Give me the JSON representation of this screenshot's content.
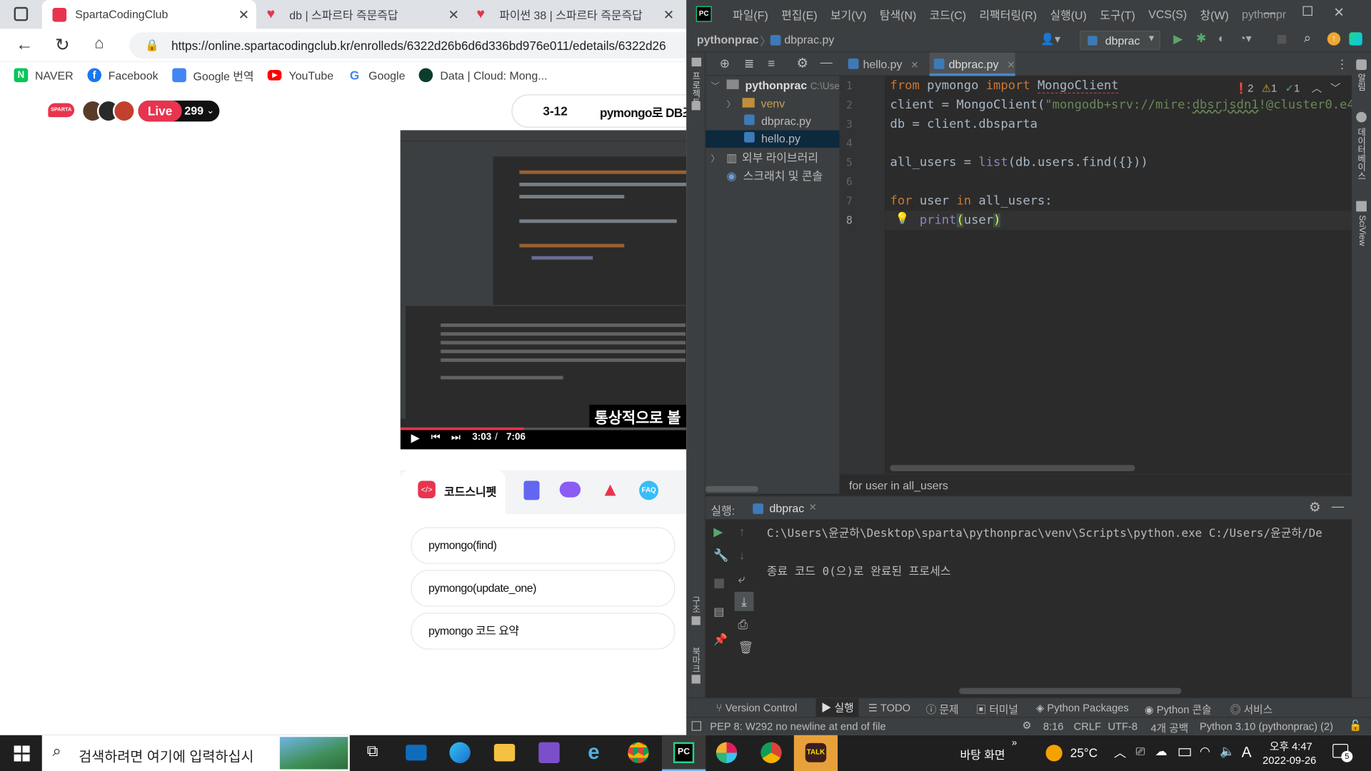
{
  "browser": {
    "tabs": [
      {
        "title": "SpartaCodingClub",
        "active": true
      },
      {
        "title": "db | 스파르타 즉문즉답",
        "active": false
      },
      {
        "title": "파이썬 38 | 스파르타 즉문즉답",
        "active": false
      }
    ],
    "url": "https://online.spartacodingclub.kr/enrolleds/6322d26b6d6d336bd976e011/edetails/6322d26",
    "bookmarks": [
      "NAVER",
      "Facebook",
      "Google 번역",
      "YouTube",
      "Google",
      "Data | Cloud: Mong..."
    ]
  },
  "page": {
    "logo": "SPARTA",
    "live_label": "Live",
    "live_count": "299",
    "lesson_number": "3-12",
    "lesson_title": "pymongo로 DB조",
    "video": {
      "current_time": "3:03",
      "time_sep": "/",
      "duration": "7:06",
      "subtitle": "통상적으로 볼",
      "progress": 0.43
    },
    "snippet_tab": "코드스니펫",
    "faq": "FAQ",
    "snippets": [
      "pymongo(find)",
      "pymongo(update_one)",
      "pymongo 코드 요약"
    ]
  },
  "ide": {
    "menu": [
      "파일(F)",
      "편집(E)",
      "보기(V)",
      "탐색(N)",
      "코드(C)",
      "리팩터링(R)",
      "실행(U)",
      "도구(T)",
      "VCS(S)",
      "창(W)",
      "pythonpr"
    ],
    "breadcrumb_project": "pythonprac",
    "breadcrumb_file": "dbprac.py",
    "run_config": "dbprac",
    "tree": {
      "root": "pythonprac",
      "root_path": "C:\\Use",
      "items": [
        "venv",
        "dbprac.py",
        "hello.py"
      ],
      "external": "외부 라이브러리",
      "scratch": "스크래치 및 콘솔"
    },
    "editor_tabs": [
      "hello.py",
      "dbprac.py"
    ],
    "inspections": {
      "errors": "2",
      "warnings": "1",
      "ok": "1"
    },
    "line_numbers": [
      "1",
      "2",
      "3",
      "4",
      "5",
      "6",
      "7",
      "8"
    ],
    "breadcrumb_hint": "for user in all_users",
    "run": {
      "label": "실행:",
      "config": "dbprac",
      "cmd": "C:\\Users\\윤균하\\Desktop\\sparta\\pythonprac\\venv\\Scripts\\python.exe C:/Users/윤균하/De",
      "exit": "종료 코드 0(으)로 완료된 프로세스"
    },
    "bottom_tabs": [
      "Version Control",
      "실행",
      "TODO",
      "문제",
      "터미널",
      "Python Packages",
      "Python 콘솔",
      "서비스"
    ],
    "status": {
      "message": "PEP 8: W292 no newline at end of file",
      "position": "8:16",
      "line_sep": "CRLF",
      "encoding": "UTF-8",
      "indent": "4개 공백",
      "interpreter": "Python 3.10 (pythonprac) (2)"
    },
    "side_labels": {
      "project": "프로젝트",
      "structure": "구조",
      "bookmarks": "북마크",
      "database": "데이터베이스",
      "sciview": "SciView",
      "notif": "알림"
    }
  },
  "taskbar": {
    "search_placeholder": "검색하려면 여기에 입력하십시",
    "desktop": "바탕 화면",
    "temp": "25°C",
    "ime": "A",
    "ampm_time": "오후 4:47",
    "date": "2022-09-26",
    "notif_count": "5"
  }
}
